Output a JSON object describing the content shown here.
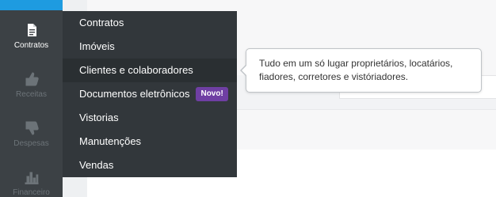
{
  "sidebar": {
    "items": [
      {
        "label": "Contratos",
        "icon": "document-icon",
        "active": true
      },
      {
        "label": "Receitas",
        "icon": "thumbs-up-icon",
        "active": false
      },
      {
        "label": "Despesas",
        "icon": "thumbs-down-icon",
        "active": false
      },
      {
        "label": "Financeiro",
        "icon": "bar-chart-icon",
        "active": false
      }
    ]
  },
  "menu": {
    "items": [
      {
        "label": "Contratos"
      },
      {
        "label": "Imóveis"
      },
      {
        "label": "Clientes e colaboradores"
      },
      {
        "label": "Documentos eletrônicos",
        "badge": "Novo!"
      },
      {
        "label": "Vistorias"
      },
      {
        "label": "Manutenções"
      },
      {
        "label": "Vendas"
      }
    ]
  },
  "tooltip": {
    "text": "Tudo em um só lugar proprietários, locatários, fiadores, corretores e vistóriadores."
  },
  "colors": {
    "sidebar_bg": "#3c4145",
    "menu_bg": "#32373b",
    "accent_top": "#1e9be0",
    "badge": "#6f3fa3"
  }
}
